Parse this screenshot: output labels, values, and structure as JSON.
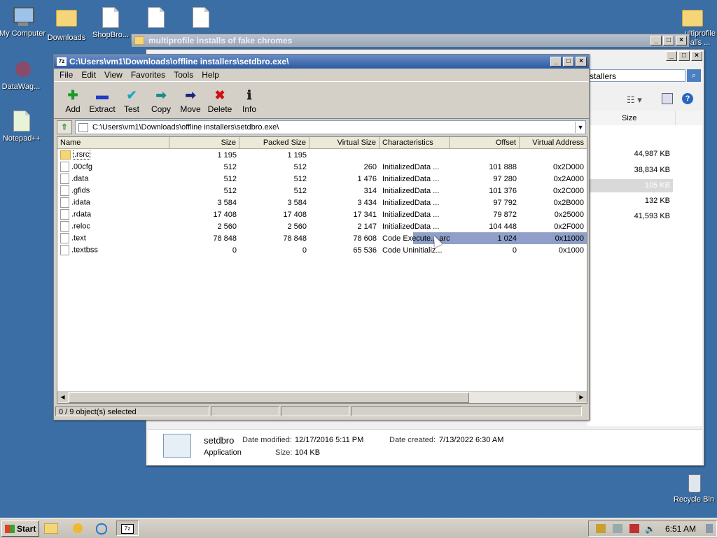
{
  "desktop": {
    "icons": [
      {
        "label": "My Computer"
      },
      {
        "label": "Downloads"
      },
      {
        "label": "ShopBro..."
      },
      {
        "label": "DataWag..."
      },
      {
        "label": "Notepad++"
      },
      {
        "label": "Recycle Bin"
      }
    ],
    "partial_right_icon": "ultiprofile\nalls ..."
  },
  "explorer_window": {
    "title": "multiprofile installs of fake chromes",
    "search_value": "stallers",
    "column_size": "Size",
    "sizes": [
      "44,987 KB",
      "38,834 KB",
      "105 KB",
      "132 KB",
      "41,593 KB"
    ],
    "details": {
      "name": "setdbro",
      "type": "Application",
      "date_modified_label": "Date modified:",
      "date_modified": "12/17/2016 5:11 PM",
      "date_created_label": "Date created:",
      "date_created": "7/13/2022 6:30 AM",
      "size_label": "Size:",
      "size": "104 KB"
    }
  },
  "zip_window": {
    "title": "C:\\Users\\vm1\\Downloads\\offline installers\\setdbro.exe\\",
    "menu": [
      "File",
      "Edit",
      "View",
      "Favorites",
      "Tools",
      "Help"
    ],
    "tools": [
      {
        "label": "Add",
        "icon": "plus-icon",
        "glyph": "✚",
        "color": "#1a9a2a"
      },
      {
        "label": "Extract",
        "icon": "minus-icon",
        "glyph": "▬",
        "color": "#1e3cc8"
      },
      {
        "label": "Test",
        "icon": "check-icon",
        "glyph": "✔",
        "color": "#18a7c0"
      },
      {
        "label": "Copy",
        "icon": "copy-arrow-icon",
        "glyph": "➡",
        "color": "#1a8a8a"
      },
      {
        "label": "Move",
        "icon": "move-arrow-icon",
        "glyph": "➡",
        "color": "#1a237e"
      },
      {
        "label": "Delete",
        "icon": "delete-x-icon",
        "glyph": "✖",
        "color": "#d01010"
      },
      {
        "label": "Info",
        "icon": "info-icon",
        "glyph": "ℹ",
        "color": "#222"
      }
    ],
    "address": "C:\\Users\\vm1\\Downloads\\offline installers\\setdbro.exe\\",
    "columns": [
      "Name",
      "Size",
      "Packed Size",
      "Virtual Size",
      "Characteristics",
      "Offset",
      "Virtual Address"
    ],
    "rows": [
      {
        "name": ".rsrc",
        "size": "1 195",
        "packed": "1 195",
        "vsize": "",
        "chars": "",
        "offset": "",
        "vaddr": "",
        "folder": true
      },
      {
        "name": ".00cfg",
        "size": "512",
        "packed": "512",
        "vsize": "260",
        "chars": "InitializedData ...",
        "offset": "101 888",
        "vaddr": "0x2D000"
      },
      {
        "name": ".data",
        "size": "512",
        "packed": "512",
        "vsize": "1 476",
        "chars": "InitializedData ...",
        "offset": "97 280",
        "vaddr": "0x2A000"
      },
      {
        "name": ".gfids",
        "size": "512",
        "packed": "512",
        "vsize": "314",
        "chars": "InitializedData ...",
        "offset": "101 376",
        "vaddr": "0x2C000"
      },
      {
        "name": ".idata",
        "size": "3 584",
        "packed": "3 584",
        "vsize": "3 434",
        "chars": "InitializedData ...",
        "offset": "97 792",
        "vaddr": "0x2B000"
      },
      {
        "name": ".rdata",
        "size": "17 408",
        "packed": "17 408",
        "vsize": "17 341",
        "chars": "InitializedData ...",
        "offset": "79 872",
        "vaddr": "0x25000"
      },
      {
        "name": ".reloc",
        "size": "2 560",
        "packed": "2 560",
        "vsize": "2 147",
        "chars": "InitializedData ...",
        "offset": "104 448",
        "vaddr": "0x2F000"
      },
      {
        "name": ".text",
        "size": "78 848",
        "packed": "78 848",
        "vsize": "78 608",
        "chars": "Code Execute... archive",
        "offset": "1 024",
        "vaddr": "0x11000"
      },
      {
        "name": ".textbss",
        "size": "0",
        "packed": "0",
        "vsize": "65 536",
        "chars": "Code Uninitializ...",
        "offset": "0",
        "vaddr": "0x1000"
      }
    ],
    "status": "0 / 9 object(s) selected"
  },
  "taskbar": {
    "start_label": "Start",
    "clock": "6:51 AM"
  }
}
